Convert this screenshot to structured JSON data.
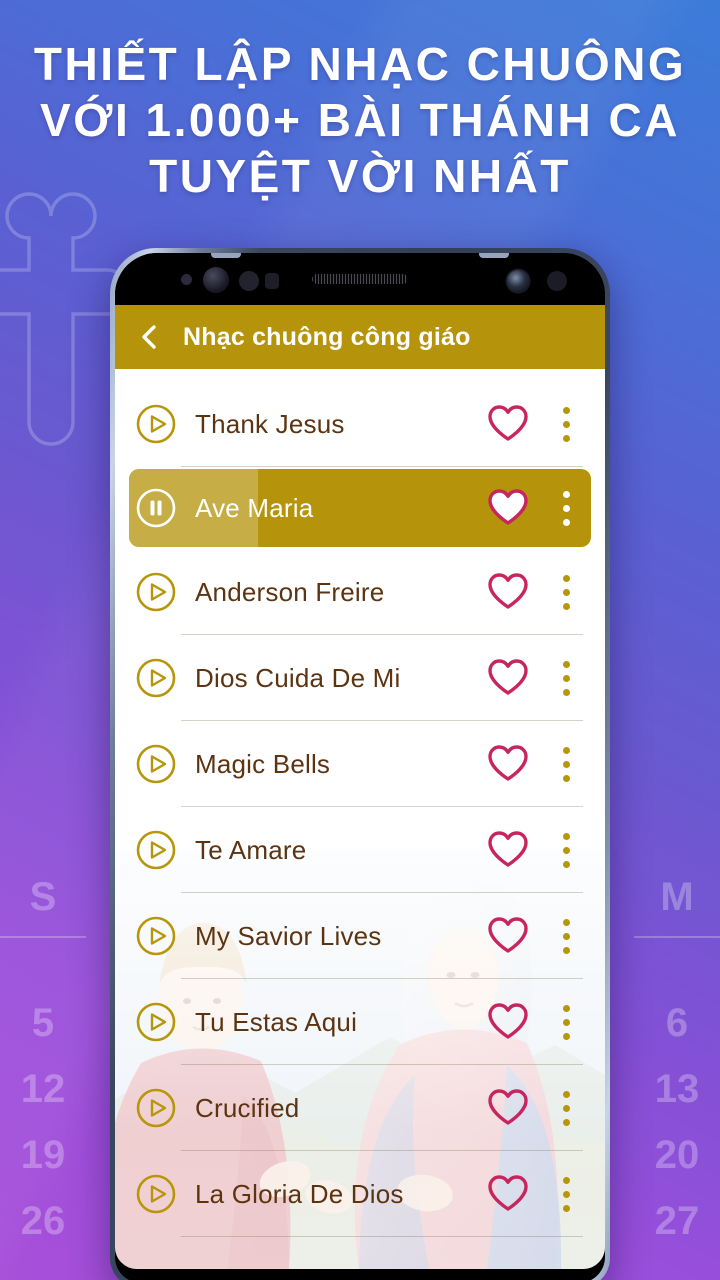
{
  "promo": {
    "headline_lines": [
      "THIẾT LẬP NHẠC CHUÔNG",
      "VỚI 1.000+ BÀI THÁNH CA",
      "TUYỆT VỜI NHẤT"
    ],
    "background_gradient_from": "#3C7CD9",
    "background_gradient_to": "#A74FDA",
    "cross_watermark_icon": "orthodox-budded-cross-icon"
  },
  "calendar_watermark": {
    "left_column": {
      "header": "S",
      "days": [
        "5",
        "12",
        "19",
        "26"
      ]
    },
    "right_column": {
      "header": "M",
      "days": [
        "6",
        "13",
        "20",
        "27"
      ]
    }
  },
  "app": {
    "appbar": {
      "back_icon": "chevron-left-icon",
      "title": "Nhạc chuông công giáo",
      "background_color": "#B5940B",
      "title_color": "#FFFFFF"
    },
    "colors": {
      "gold": "#B5940B",
      "gold_light": "#C4A93E",
      "heart": "#C8255F",
      "song_title": "#5C3412",
      "kebab_dot": "#B8960C"
    },
    "songs": [
      {
        "title": "Thank Jesus",
        "state": "paused",
        "play_icon": "play-circle-icon",
        "favorite": false,
        "heart_icon": "heart-outline-icon",
        "menu_icon": "kebab-menu-icon",
        "progress": 0
      },
      {
        "title": "Ave Maria",
        "state": "playing",
        "play_icon": "pause-circle-icon",
        "favorite": true,
        "heart_icon": "heart-filled-icon",
        "menu_icon": "kebab-menu-icon",
        "progress": 28
      },
      {
        "title": "Anderson Freire",
        "state": "paused",
        "play_icon": "play-circle-icon",
        "favorite": false,
        "heart_icon": "heart-outline-icon",
        "menu_icon": "kebab-menu-icon",
        "progress": 0
      },
      {
        "title": "Dios Cuida De Mi",
        "state": "paused",
        "play_icon": "play-circle-icon",
        "favorite": false,
        "heart_icon": "heart-outline-icon",
        "menu_icon": "kebab-menu-icon",
        "progress": 0
      },
      {
        "title": "Magic Bells",
        "state": "paused",
        "play_icon": "play-circle-icon",
        "favorite": false,
        "heart_icon": "heart-outline-icon",
        "menu_icon": "kebab-menu-icon",
        "progress": 0
      },
      {
        "title": "Te Amare",
        "state": "paused",
        "play_icon": "play-circle-icon",
        "favorite": false,
        "heart_icon": "heart-outline-icon",
        "menu_icon": "kebab-menu-icon",
        "progress": 0
      },
      {
        "title": "My Savior Lives",
        "state": "paused",
        "play_icon": "play-circle-icon",
        "favorite": false,
        "heart_icon": "heart-outline-icon",
        "menu_icon": "kebab-menu-icon",
        "progress": 0
      },
      {
        "title": "Tu Estas Aqui",
        "state": "paused",
        "play_icon": "play-circle-icon",
        "favorite": false,
        "heart_icon": "heart-outline-icon",
        "menu_icon": "kebab-menu-icon",
        "progress": 0
      },
      {
        "title": "Crucified",
        "state": "paused",
        "play_icon": "play-circle-icon",
        "favorite": false,
        "heart_icon": "heart-outline-icon",
        "menu_icon": "kebab-menu-icon",
        "progress": 0
      },
      {
        "title": "La Gloria De Dios",
        "state": "paused",
        "play_icon": "play-circle-icon",
        "favorite": false,
        "heart_icon": "heart-outline-icon",
        "menu_icon": "kebab-menu-icon",
        "progress": 0
      }
    ]
  },
  "device": {
    "speaker_icon": "earpiece-speaker-icon",
    "camera_icon": "front-camera-icon",
    "sensor_icon": "proximity-sensor-icon"
  }
}
